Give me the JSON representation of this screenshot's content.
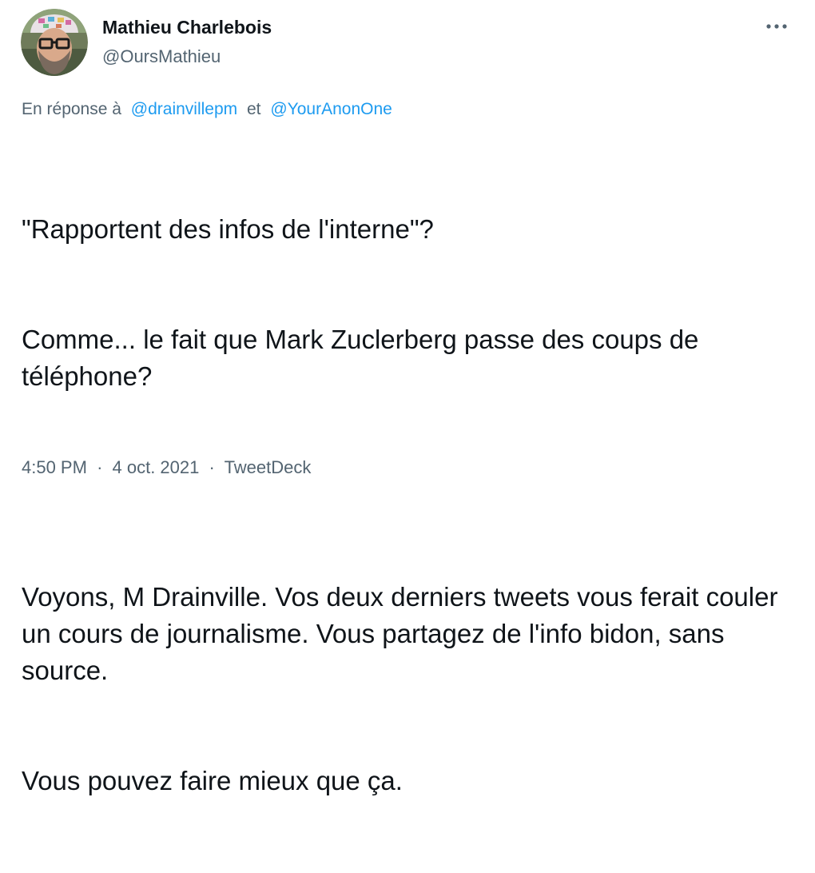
{
  "tweet": {
    "author": {
      "display_name": "Mathieu Charlebois",
      "handle": "@OursMathieu",
      "avatar_icon": "user-avatar-photo"
    },
    "more_icon": "more-options-icon",
    "reply": {
      "prefix": "En réponse à",
      "mention_1": "@drainvillepm",
      "conjunction": "et",
      "mention_2": "@YourAnonOne"
    },
    "text": {
      "para1_line1": "\"Rapportent des infos de l'interne\"?",
      "para1_line2": "Comme... le fait que Mark Zuclerberg passe des coups de téléphone?",
      "para2_line1": "Voyons, M Drainville. Vos deux derniers tweets vous ferait couler un cours de journalisme. Vous partagez de l'info bidon, sans source.",
      "para2_line2": "Vous pouvez faire mieux que ça."
    },
    "meta": {
      "time": "4:50 PM",
      "separator": "·",
      "date": "4 oct. 2021",
      "source": "TweetDeck"
    }
  },
  "colors": {
    "text_primary": "#0f1419",
    "text_secondary": "#536471",
    "link": "#1d9bf0",
    "background": "#ffffff"
  }
}
